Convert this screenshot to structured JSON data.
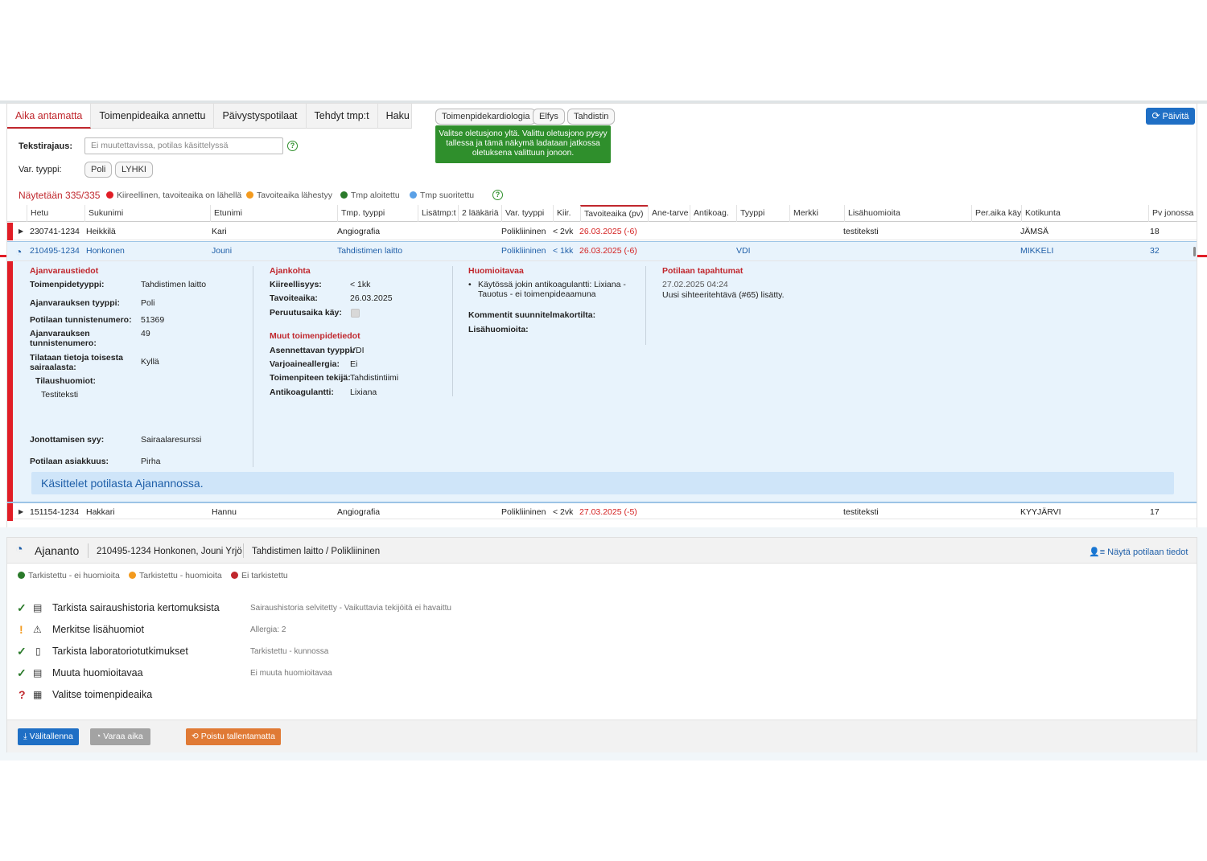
{
  "tabs": [
    "Aika antamatta",
    "Toimenpideaika annettu",
    "Päivystyspotilaat",
    "Tehdyt tmp:t",
    "Haku"
  ],
  "queue_chips": [
    "Toimenpidekardiologia",
    "Elfys",
    "Tahdistin"
  ],
  "tooltip": "Valitse oletusjono yltä. Valittu oletusjono pysyy tallessa ja tämä näkymä ladataan jatkossa oletuksena valittuun jonoon.",
  "refresh_label": "Päivitä",
  "filters": {
    "text_label": "Tekstirajaus:",
    "text_placeholder": "Ei muutettavissa, potilas käsittelyssä",
    "type_label": "Var. tyyppi:",
    "type_chips": [
      "Poli",
      "LYHKI"
    ]
  },
  "showing": "Näytetään 335/335",
  "legend": [
    {
      "label": "Kiireellinen, tavoiteaika on lähellä",
      "color": "#e11d26"
    },
    {
      "label": "Tavoiteaika lähestyy",
      "color": "#f39a1e"
    },
    {
      "label": "Tmp aloitettu",
      "color": "#2a7a2a"
    },
    {
      "label": "Tmp suoritettu",
      "color": "#5aa0e6"
    }
  ],
  "columns": [
    "Hetu",
    "Sukunimi",
    "Etunimi",
    "Tmp. tyyppi",
    "Lisätmp:t",
    "2 lääkäriä",
    "Var. tyyppi",
    "Kiir.",
    "Tavoiteaika (pv)",
    "Ane-tarve",
    "Antikoag.",
    "Tyyppi",
    "Merkki",
    "Lisähuomioita",
    "Per.aika käy",
    "Kotikunta",
    "Pv jonossa"
  ],
  "rows": [
    {
      "hetu": "230741-1234",
      "sukunimi": "Heikkilä",
      "etunimi": "Kari",
      "tmp": "Angiografia",
      "var": "Polikliininen",
      "kiir": "< 2vk",
      "tavoite": "26.03.2025 (-6)",
      "tyyppi": "",
      "lisa": "testiteksti",
      "kunta": "JÄMSÄ",
      "pv": "18"
    },
    {
      "hetu": "210495-1234",
      "sukunimi": "Honkonen",
      "etunimi": "Jouni",
      "tmp": "Tahdistimen laitto",
      "var": "Polikliininen",
      "kiir": "< 1kk",
      "tavoite": "26.03.2025 (-6)",
      "tyyppi": "VDI",
      "lisa": "",
      "kunta": "MIKKELI",
      "pv": "32"
    },
    {
      "hetu": "151154-1234",
      "sukunimi": "Hakkari",
      "etunimi": "Hannu",
      "tmp": "Angiografia",
      "var": "Polikliininen",
      "kiir": "< 2vk",
      "tavoite": "27.03.2025 (-5)",
      "tyyppi": "",
      "lisa": "testiteksti",
      "kunta": "KYYJÄRVI",
      "pv": "17"
    }
  ],
  "detail": {
    "col1_title": "Ajanvaraustiedot",
    "col1": [
      {
        "label": "Toimenpidetyyppi:",
        "value": "Tahdistimen laitto"
      },
      {
        "label": "Ajanvarauksen tyyppi:",
        "value": "Poli"
      },
      {
        "label": "Potilaan tunnistenumero:",
        "value": "51369"
      },
      {
        "label": "Ajanvarauksen tunnistenumero:",
        "value": "49"
      },
      {
        "label": "Tilataan tietoja toisesta sairaalasta:",
        "value": "Kyllä"
      },
      {
        "label": "Tilaushuomiot:",
        "value": "Testiteksti"
      },
      {
        "label": "Jonottamisen syy:",
        "value": "Sairaalaresurssi"
      },
      {
        "label": "Potilaan asiakkuus:",
        "value": "Pirha"
      }
    ],
    "col2_title": "Ajankohta",
    "col2": [
      {
        "label": "Kiireellisyys:",
        "value": "< 1kk"
      },
      {
        "label": "Tavoiteaika:",
        "value": "26.03.2025"
      },
      {
        "label": "Peruutusaika käy:",
        "value": ""
      }
    ],
    "col2b_title": "Muut toimenpidetiedot",
    "col2b": [
      {
        "label": "Asennettavan tyyppi:",
        "value": "VDI"
      },
      {
        "label": "Varjoaineallergia:",
        "value": "Ei"
      },
      {
        "label": "Toimenpiteen tekijä:",
        "value": "Tahdistintiimi"
      },
      {
        "label": "Antikoagulantti:",
        "value": "Lixiana"
      }
    ],
    "col3_title": "Huomioitavaa",
    "col3_bullet": "Käytössä jokin antikoagulantti: Lixiana - Tauotus - ei toimenpideaamuna",
    "col3_comments": "Kommentit suunnitelmakortilta:",
    "col3_extra": "Lisähuomioita:",
    "col4_title": "Potilaan tapahtumat",
    "col4_date": "27.02.2025 04:24",
    "col4_text": "Uusi sihteeritehtävä (#65) lisätty.",
    "notice": "Käsittelet potilasta Ajanannossa."
  },
  "bottom": {
    "title": "Ajananto",
    "patient": "210495-1234 Honkonen, Jouni Yrjö",
    "procedure": "Tahdistimen laitto / Polikliininen",
    "show_info": "Näytä potilaan tiedot",
    "legend": [
      {
        "label": "Tarkistettu - ei huomioita",
        "color": "#2a7a2a"
      },
      {
        "label": "Tarkistettu - huomioita",
        "color": "#f39a1e"
      },
      {
        "label": "Ei tarkistettu",
        "color": "#c0272d"
      }
    ],
    "tasks": [
      {
        "status": "✓",
        "status_color": "#2a7a2a",
        "icon": "📄",
        "label": "Tarkista sairaushistoria kertomuksista",
        "note": "Sairaushistoria selvitetty - Vaikuttavia tekijöitä ei havaittu"
      },
      {
        "status": "!",
        "status_color": "#f39a1e",
        "icon": "⚠",
        "label": "Merkitse lisähuomiot",
        "note": "Allergia: 2"
      },
      {
        "status": "✓",
        "status_color": "#2a7a2a",
        "icon": "🧪",
        "label": "Tarkista laboratoriotutkimukset",
        "note": "Tarkistettu - kunnossa"
      },
      {
        "status": "✓",
        "status_color": "#2a7a2a",
        "icon": "▤",
        "label": "Muuta huomioitavaa",
        "note": "Ei muuta huomioitavaa"
      },
      {
        "status": "?",
        "status_color": "#c0272d",
        "icon": "▦",
        "label": "Valitse toimenpideaika",
        "note": ""
      }
    ],
    "buttons": [
      {
        "label": "Välitallenna",
        "color": "#1f6fc5"
      },
      {
        "label": "Varaa aika",
        "color": "#a3a3a3"
      },
      {
        "label": "Poistu tallentamatta",
        "color": "#e07a35"
      }
    ]
  }
}
